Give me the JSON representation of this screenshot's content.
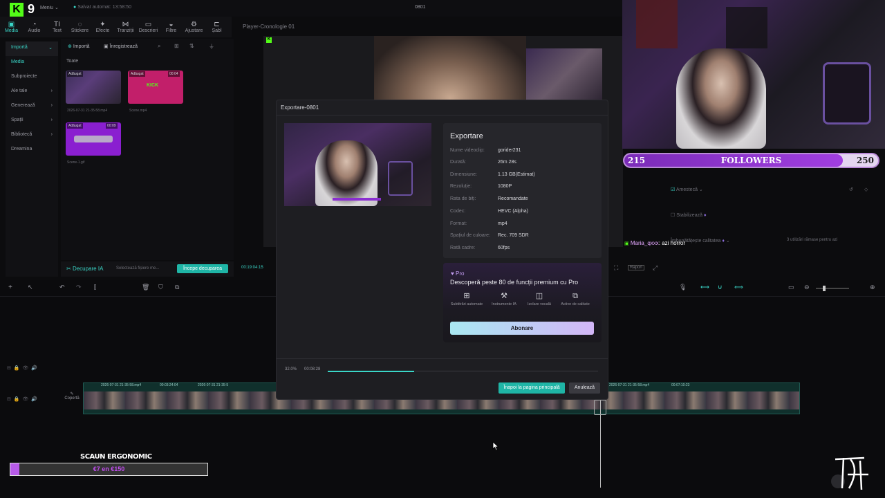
{
  "app": {
    "menu_label": "Meniu",
    "save_status": "Salvat automat: 13:58:50",
    "project_name": "0801",
    "kick_badge": "9"
  },
  "toolbar": {
    "items": [
      {
        "label": "Media",
        "icon": "media-icon"
      },
      {
        "label": "Audio",
        "icon": "audio-icon"
      },
      {
        "label": "Text",
        "icon": "text-icon"
      },
      {
        "label": "Stickere",
        "icon": "sticker-icon"
      },
      {
        "label": "Efecte",
        "icon": "effects-icon"
      },
      {
        "label": "Tranziții",
        "icon": "transitions-icon"
      },
      {
        "label": "Descrieri",
        "icon": "captions-icon"
      },
      {
        "label": "Filtre",
        "icon": "filters-icon"
      },
      {
        "label": "Ajustare",
        "icon": "adjust-icon"
      },
      {
        "label": "Șabl",
        "icon": "templates-icon"
      }
    ]
  },
  "left_nav": {
    "items": [
      {
        "label": "Importă"
      },
      {
        "label": "Media"
      },
      {
        "label": "Subproiecte"
      },
      {
        "label": "Ale tale"
      },
      {
        "label": "Generează"
      },
      {
        "label": "Spații"
      },
      {
        "label": "Bibliotecă"
      },
      {
        "label": "Dreamina"
      }
    ]
  },
  "media_panel": {
    "import_label": "Importă",
    "record_label": "Înregistrează",
    "section_label": "Toate",
    "items": [
      {
        "badge": "Adăugat",
        "duration": "",
        "name": "2026-07-31 21-35-58.mp4"
      },
      {
        "badge": "Adăugat",
        "duration": "00:04",
        "name": "Scene.mp4",
        "content": "KICK"
      },
      {
        "badge": "Adăugat",
        "duration": "00:09",
        "name": "Scene-1.gif"
      }
    ],
    "ai_cut_label": "Decupare IA",
    "ai_cut_hint": "Selectează fișiere me...",
    "ai_cut_button": "Începe decuparea"
  },
  "player": {
    "title": "Player-Cronologie 01",
    "time": "00:19:04:15",
    "ratio_label": "Raport"
  },
  "right_panel": {
    "mix_label": "Amestecă",
    "stabilize_label": "Stabilizează",
    "quality_label": "Îmbunătățește calitatea",
    "quality_hint": "3 utilizări rămase pentru azi"
  },
  "stream_overlay": {
    "followers_label": "FOLLOWERS",
    "followers_current": "215",
    "followers_goal": "250",
    "followers_progress": 0.86,
    "chat_user": "Maria_qxxx",
    "chat_message": ": azi horror",
    "scaun_title": "SCAUN ERGONOMIC",
    "scaun_amount": "€7 en €150",
    "scaun_progress": 0.047
  },
  "export_dialog": {
    "title": "Exportare-0801",
    "info_title": "Exportare",
    "fields": [
      {
        "key": "Nume videoclip:",
        "value": "gorider231"
      },
      {
        "key": "Durată:",
        "value": "26m 28s"
      },
      {
        "key": "Dimensiune:",
        "value": "1.13 GB(Estimat)"
      },
      {
        "key": "Rezoluție:",
        "value": "1080P"
      },
      {
        "key": "Rata de biți:",
        "value": "Recomandate"
      },
      {
        "key": "Codec:",
        "value": "HEVC  (Alpha)"
      },
      {
        "key": "Format:",
        "value": "mp4"
      },
      {
        "key": "Spațiul de culoare:",
        "value": "Rec. 709 SDR"
      },
      {
        "key": "Rată cadre:",
        "value": "60fps"
      }
    ],
    "pro": {
      "badge": "Pro",
      "description": "Descoperă peste 80 de funcții premium cu Pro",
      "features": [
        {
          "label": "Subtitrări automate",
          "icon": "subtitles-grid-icon"
        },
        {
          "label": "Instrumente IA",
          "icon": "magic-wand-icon"
        },
        {
          "label": "Izolare vocală",
          "icon": "voice-isolation-icon"
        },
        {
          "label": "Active de calitate",
          "icon": "quality-assets-icon"
        }
      ],
      "subscribe_label": "Abonare"
    },
    "progress_percent": "32.0%",
    "progress_value": 0.32,
    "elapsed": "00:08:28",
    "home_button": "Înapoi la pagina principală",
    "cancel_button": "Anulează"
  },
  "timeline": {
    "cover_label": "Copertă",
    "clip_labels": [
      "2026-07-31 21-35-58.mp4",
      "00:03:24:04",
      "2026-07-31 21-35-5",
      "2026-07-31 21-35-58.mp4",
      "00:07:10:23"
    ]
  }
}
